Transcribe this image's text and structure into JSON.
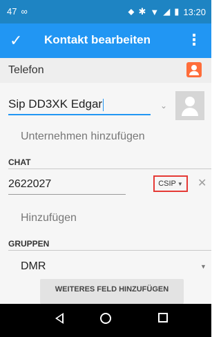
{
  "status_bar": {
    "left_number": "47",
    "icons": [
      "location-icon",
      "bluetooth-icon",
      "wifi-icon",
      "signal-icon",
      "battery-icon"
    ],
    "time": "13:20"
  },
  "app_bar": {
    "title": "Kontakt bearbeiten",
    "confirm_icon": "check-icon",
    "menu_icon": "overflow-menu-icon"
  },
  "account": {
    "label": "Telefon",
    "icon": "contact-account-icon"
  },
  "name": {
    "value": "Sip DD3XK Edgar"
  },
  "company": {
    "placeholder": "Unternehmen hinzufügen"
  },
  "chat": {
    "header": "CHAT",
    "value": "2622027",
    "type_label": "CSIP",
    "add_label": "Hinzufügen"
  },
  "groups": {
    "header": "GRUPPEN",
    "value": "DMR"
  },
  "add_field_button": "WEITERES FELD HINZUFÜGEN",
  "colors": {
    "status_bar": "#1e84c3",
    "app_bar": "#2196f3",
    "highlight_box": "#e53935",
    "account_icon": "#ff6d3a"
  }
}
